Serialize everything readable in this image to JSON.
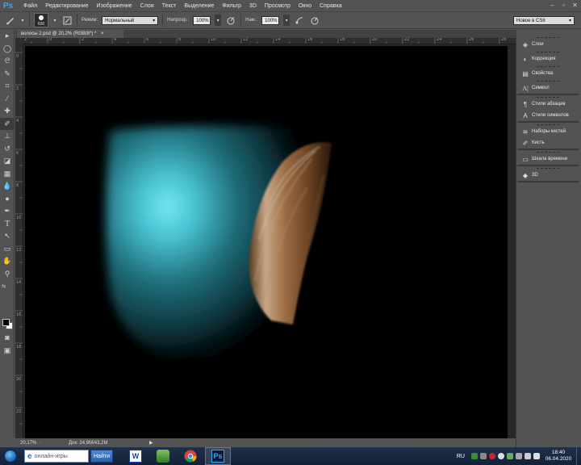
{
  "app": {
    "logo": "Ps"
  },
  "menu": [
    "Файл",
    "Редактирование",
    "Изображение",
    "Слои",
    "Текст",
    "Выделение",
    "Фильтр",
    "3D",
    "Просмотр",
    "Окно",
    "Справка"
  ],
  "options": {
    "brush_size": "600",
    "mode_label": "Режим:",
    "mode_value": "Нормальный",
    "opacity_label": "Непрозр.:",
    "opacity_value": "100%",
    "flow_label": "Наж.:",
    "flow_value": "100%",
    "workspace": "Новое в CS6"
  },
  "document": {
    "tab_title": "волосы 2.psd @ 20,2% (RGB/8*) *",
    "close": "×"
  },
  "ruler": {
    "h_labels": [
      "2",
      "0",
      "2",
      "4",
      "6",
      "8",
      "10",
      "12",
      "14",
      "16",
      "18",
      "20",
      "22",
      "24",
      "26",
      "28"
    ],
    "v_labels": [
      "0",
      "2",
      "4",
      "6",
      "8",
      "10",
      "12",
      "14",
      "16",
      "18",
      "20",
      "22"
    ]
  },
  "status": {
    "zoom": "20,17%",
    "doc_info": "Док: 24,9M/43,2M"
  },
  "panels": {
    "group1": [
      {
        "icon": "layers-icon",
        "label": "Слои"
      },
      {
        "icon": "adjustments-icon",
        "label": "Коррекция"
      },
      {
        "icon": "properties-icon",
        "label": "Свойства"
      },
      {
        "icon": "character-icon",
        "label": "Символ"
      }
    ],
    "group2": [
      {
        "icon": "paragraph-styles-icon",
        "label": "Стили абзацев"
      },
      {
        "icon": "character-styles-icon",
        "label": "Стили символов"
      }
    ],
    "group3": [
      {
        "icon": "brush-presets-icon",
        "label": "Наборы кистей"
      },
      {
        "icon": "brush-icon",
        "label": "Кисть"
      }
    ],
    "group4": [
      {
        "icon": "timeline-icon",
        "label": "Шкала времени"
      }
    ],
    "group5": [
      {
        "icon": "3d-icon",
        "label": "3D"
      }
    ]
  },
  "taskbar": {
    "search_placeholder": "онлайн-игры",
    "search_button": "Найти",
    "lang": "RU",
    "time": "18:40",
    "date": "06.04.2020"
  },
  "colors": {
    "ps_blue": "#31a8ff",
    "ui_gray": "#535353",
    "canvas_bg": "#000000",
    "glow_cyan": "#6fe3f0",
    "hair_brown": "#9a6b42"
  }
}
